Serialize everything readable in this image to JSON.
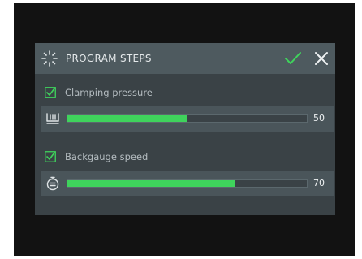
{
  "header": {
    "title": "PROGRAM STEPS",
    "program_icon": "program-steps-icon",
    "confirm_icon": "checkmark-icon",
    "close_icon": "close-icon"
  },
  "steps": [
    {
      "label": "Clamping pressure",
      "checked": true,
      "icon": "clamp-pressure-icon",
      "value": "50",
      "level": 0.5
    },
    {
      "label": "Backgauge speed",
      "checked": true,
      "icon": "speed-gauge-icon",
      "value": "70",
      "level": 0.7
    }
  ],
  "colors": {
    "accent": "#3fd35c",
    "screen_bg": "#3a4246",
    "header_bg": "#4e5a5f"
  }
}
